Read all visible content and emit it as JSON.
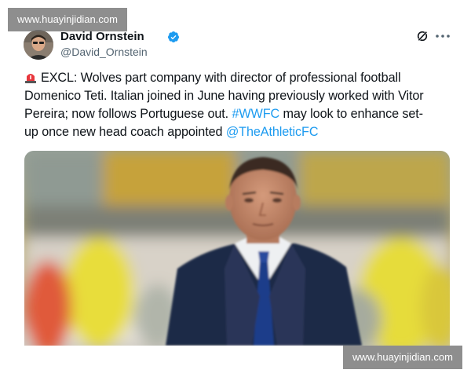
{
  "watermark": {
    "top": "www.huayinjidian.com",
    "bottom": "www.huayinjidian.com"
  },
  "author": {
    "name": "David Ornstein",
    "handle": "@David_Ornstein",
    "verified": true
  },
  "icons": {
    "verified": "verified-badge-icon",
    "grok": "grok-icon",
    "more": "more-options-icon",
    "siren": "police-light-emoji"
  },
  "tweet": {
    "line1": "EXCL: Wolves part company with director of professional football",
    "line2": "Domenico Teti. Italian joined in June having previously worked with Vitor",
    "line3": "Pereira; now follows Portuguese out.",
    "hashtag": "#WWFC",
    "line3_after": "may look to enhance set-",
    "line4": "up once new head coach appointed",
    "mention": "@TheAthleticFC"
  },
  "colors": {
    "text": "#0f1419",
    "secondary": "#536471",
    "link": "#1d9bf0",
    "verified": "#1d9bf0"
  }
}
